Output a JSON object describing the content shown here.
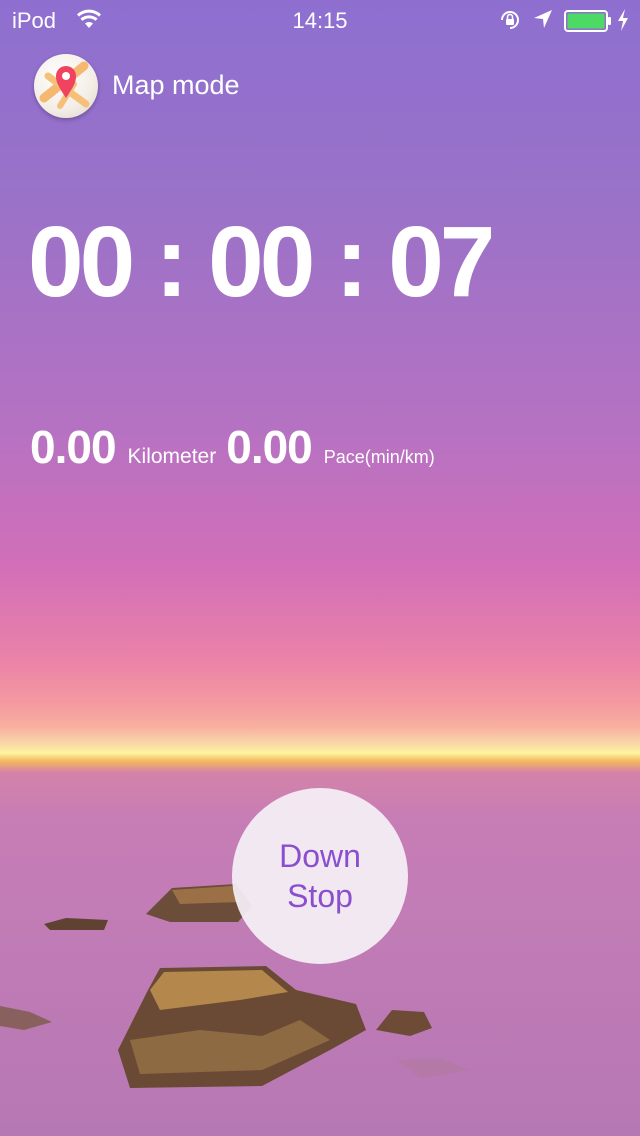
{
  "status_bar": {
    "carrier": "iPod",
    "time": "14:15",
    "icons": [
      "wifi-icon",
      "rotation-lock-icon",
      "location-arrow-icon",
      "battery-icon",
      "charging-bolt-icon"
    ],
    "battery_color": "#4cd964"
  },
  "map_mode": {
    "label": "Map mode",
    "icon": "map-pin-icon"
  },
  "timer": {
    "value": "00 : 00 : 07"
  },
  "stats": {
    "distance_value": "0.00",
    "distance_unit": "Kilometer",
    "pace_value": "0.00",
    "pace_unit": "Pace(min/km)"
  },
  "stop_button": {
    "line1": "Down",
    "line2": "Stop",
    "text_color": "#8a4fcf"
  }
}
